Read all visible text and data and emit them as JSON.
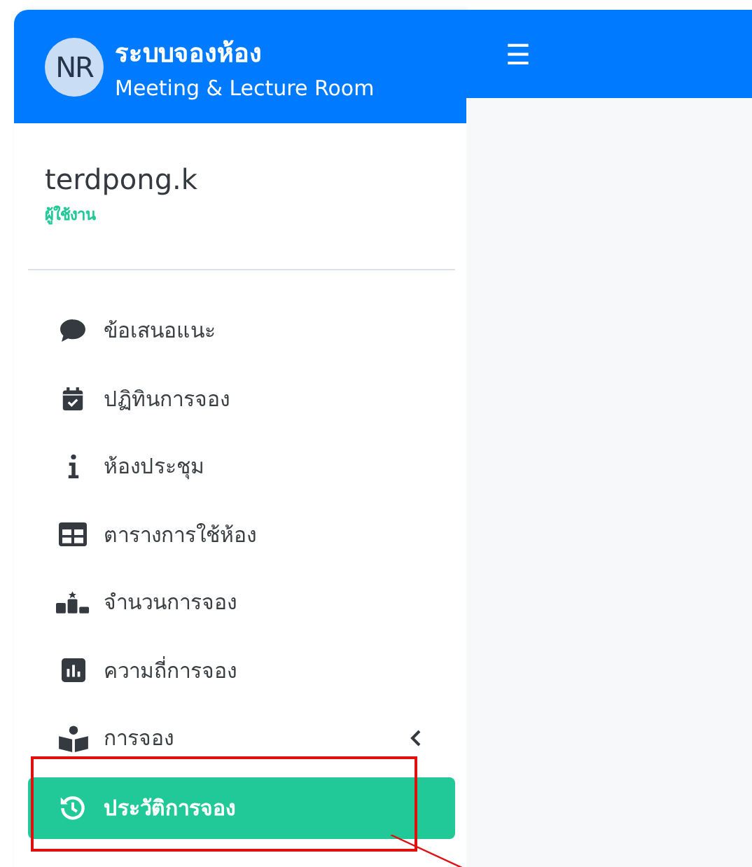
{
  "brand": {
    "avatar": "NR",
    "title": "ระบบจองห้อง",
    "subtitle": "Meeting & Lecture Room"
  },
  "topbar": {
    "menu_glyph": "☰"
  },
  "user": {
    "name": "terdpong.k",
    "role": "ผู้ใช้งาน"
  },
  "menu": [
    {
      "label": "ข้อเสนอแนะ",
      "kind": "link",
      "selected": false
    },
    {
      "label": "ปฏิทินการจอง",
      "kind": "link",
      "selected": false
    },
    {
      "label": "ห้องประชุม",
      "kind": "link",
      "selected": false
    },
    {
      "label": "ตารางการใช้ห้อง",
      "kind": "link",
      "selected": false
    },
    {
      "label": "จำนวนการจอง",
      "kind": "link",
      "selected": false
    },
    {
      "label": "ความถี่การจอง",
      "kind": "link",
      "selected": false
    },
    {
      "label": "การจอง",
      "kind": "group",
      "expanded": false,
      "selected": false
    },
    {
      "label": "ประวัติการจอง",
      "kind": "link",
      "selected": true
    }
  ]
}
